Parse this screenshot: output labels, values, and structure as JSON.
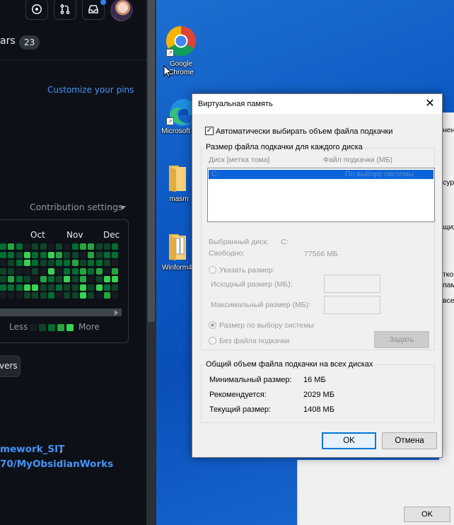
{
  "github": {
    "stars_tab_label": "ars",
    "stars_count": "23",
    "customize_pins": "Customize your pins",
    "contribution_settings": "Contribution settings",
    "months": [
      "Oct",
      "Nov",
      "Dec"
    ],
    "legend_less": "Less",
    "legend_more": "More",
    "followers_button": "vers",
    "link1": "mework_SIT",
    "link1_suffix": ",",
    "link2": "70/MyObsidianWorks",
    "colors": {
      "bg": "#0d1117",
      "link": "#4493f8",
      "green_levels": [
        "#161b22",
        "#0e4429",
        "#006d32",
        "#26a641",
        "#39d353"
      ]
    }
  },
  "desktop": {
    "icons": [
      {
        "name": "chrome",
        "label_line1": "Google",
        "label_line2": "Chrome"
      },
      {
        "name": "edge",
        "label_line1": "Microsoft Ed",
        "label_line2": ""
      },
      {
        "name": "folder-masm",
        "label_line1": "masm",
        "label_line2": ""
      },
      {
        "name": "winform",
        "label_line1": "Winform4_",
        "label_line2": ""
      }
    ],
    "background_window": {
      "snippets": [
        "нени",
        "сур",
        "щих",
        "тко",
        "пам",
        "все"
      ],
      "ok_button": "OK"
    }
  },
  "dialog": {
    "title": "Виртуальная память",
    "close_glyph": "✕",
    "auto_manage_label": "Автоматически выбирать объем файла подкачки",
    "auto_manage_checked": true,
    "per_drive_group": "Размер файла подкачки для каждого диска",
    "col_drive": "Диск [метка тома]",
    "col_size": "Файл подкачки (МБ)",
    "drive_row": {
      "drive": "C:",
      "size": "По выбору системы"
    },
    "selected_drive_label": "Выбранный диск:",
    "selected_drive_value": "C:",
    "free_label": "Свободно:",
    "free_value": "77566 МБ",
    "custom_size_label": "Указать размер:",
    "initial_size_label": "Исходный размер (МБ):",
    "max_size_label": "Максимальный размер (МБ):",
    "system_managed_label": "Размер по выбору системы",
    "no_paging_label": "Без файла подкачки",
    "set_button": "Задать",
    "total_group": "Общий объем файла подкачки на всех дисках",
    "min_label": "Минимальный размер:",
    "min_value": "16 МБ",
    "recommended_label": "Рекомендуется:",
    "recommended_value": "2029 МБ",
    "current_label": "Текущий размер:",
    "current_value": "1408 МБ",
    "ok_button": "OK",
    "cancel_button": "Отмена"
  }
}
